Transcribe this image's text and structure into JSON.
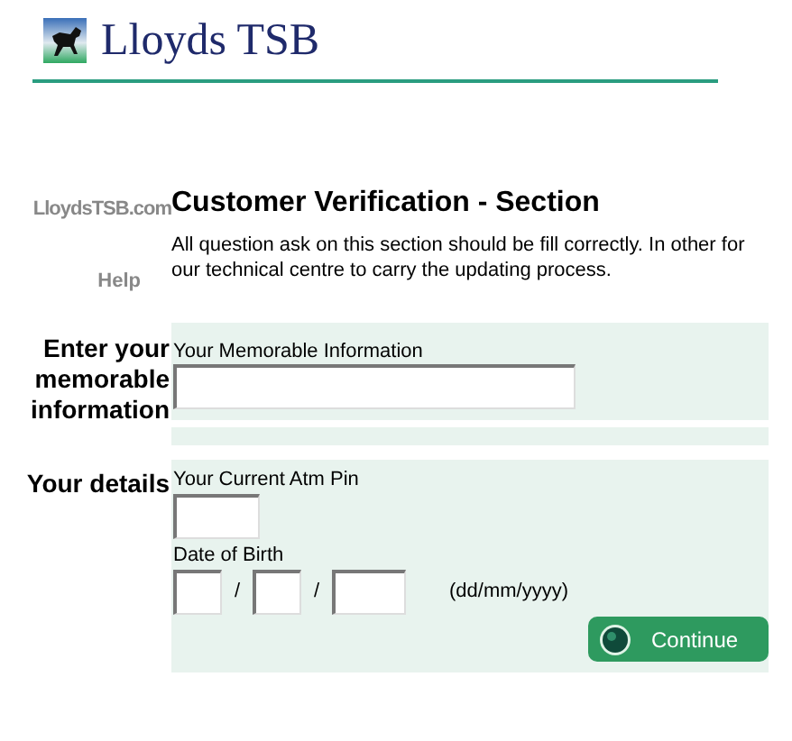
{
  "header": {
    "brand": "Lloyds TSB"
  },
  "sidebar": {
    "site": "LloydsTSB.com",
    "help": "Help"
  },
  "section": {
    "title": "Customer Verification - Section",
    "intro": "All question ask on this section should be fill correctly. In other for our technical centre to carry the updating process."
  },
  "memorable": {
    "heading": "Enter your memorable information",
    "field_label": "Your Memorable Information"
  },
  "details": {
    "heading": "Your details",
    "pin_label": "Your Current Atm Pin",
    "dob_label": "Date of Birth",
    "separators": [
      "/",
      "/"
    ],
    "format_hint": "(dd/mm/yyyy)"
  },
  "continue_button": {
    "label": "Continue"
  }
}
